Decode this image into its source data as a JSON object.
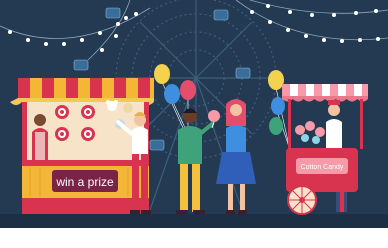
{
  "scene": {
    "alt": "flat illustration of a night carnival: ferris wheel, prize game booth, three friends with balloons, cotton candy cart",
    "booth_sign": "win a prize",
    "cart_sign": "Cotton Candy",
    "colors": {
      "night_sky": "#233a52",
      "ground": "#1c2f44",
      "wheel": "#3c5f7e",
      "booth_red": "#d8334f",
      "booth_yellow": "#f4b637",
      "cart_pink": "#f59aa6",
      "bulb": "#ffffff"
    }
  }
}
